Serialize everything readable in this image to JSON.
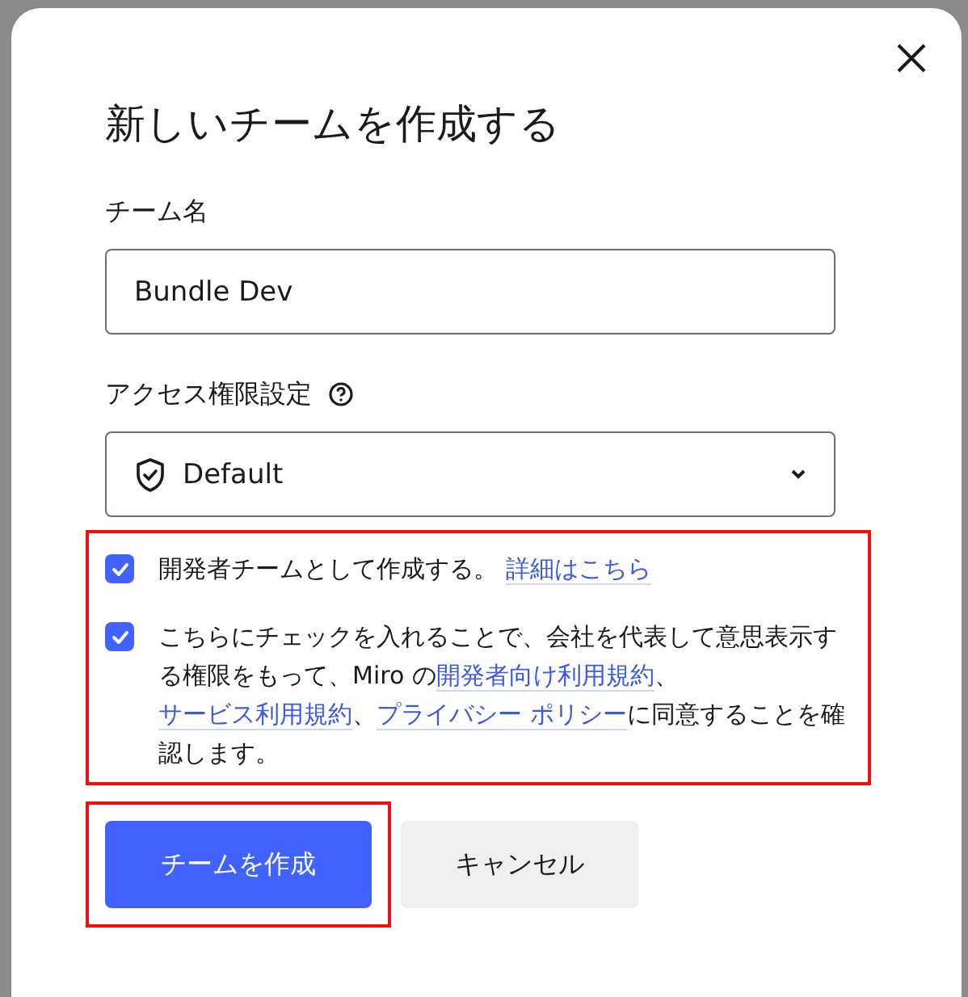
{
  "dialog": {
    "title": "新しいチームを作成する",
    "team_name": {
      "label": "チーム名",
      "value": "Bundle Dev"
    },
    "access": {
      "label": "アクセス権限設定",
      "value": "Default"
    },
    "consent": {
      "highlighted": true,
      "items": [
        {
          "checked": true,
          "parts": [
            {
              "text": "開発者チームとして作成する。 ",
              "link": false
            },
            {
              "text": "詳細はこちら",
              "link": true
            }
          ]
        },
        {
          "checked": true,
          "parts": [
            {
              "text": "こちらにチェックを入れることで、会社を代表して意思表示する権限をもって、Miro の",
              "link": false
            },
            {
              "text": "開発者向け利用規約",
              "link": true
            },
            {
              "text": "、",
              "link": false
            },
            {
              "text": "サービス利用規約",
              "link": true
            },
            {
              "text": "、",
              "link": false
            },
            {
              "text": "プライバシー ポリシー",
              "link": true
            },
            {
              "text": "に同意することを確認します。",
              "link": false
            }
          ]
        }
      ]
    },
    "buttons": [
      {
        "label": "チームを作成",
        "kind": "primary",
        "highlighted": true
      },
      {
        "label": "キャンセル",
        "kind": "secondary"
      }
    ]
  }
}
